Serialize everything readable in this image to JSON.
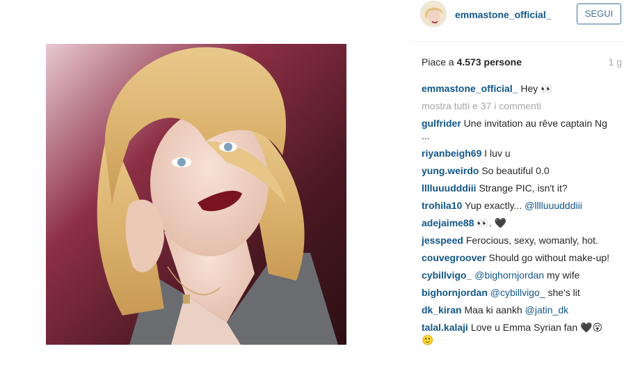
{
  "post": {
    "username": "emmastone_official_",
    "follow_label": "SEGUI",
    "likes_prefix": "Piace a ",
    "likes_count": "4.573 persone",
    "time_ago": "1 g",
    "caption_author": "emmastone_official_",
    "caption_text": "Hey 👀",
    "show_all_comments": "mostra tutti e 37 i commenti"
  },
  "comments": [
    {
      "author": "gulfrider",
      "text": "Une invitation au rêve captain Ng ..."
    },
    {
      "author": "riyanbeigh69",
      "text": "I luv u"
    },
    {
      "author": "yung.weirdo",
      "text": "So beautiful 0.0"
    },
    {
      "author": "lllluuudddiii",
      "text": "Strange PIC, isn't it?"
    },
    {
      "author": "trohila10",
      "text": "Yup exactly... ",
      "mention": "@lllluuudddiii"
    },
    {
      "author": "adejaime88",
      "text": "👀. 🖤"
    },
    {
      "author": "jesspeed",
      "text": "Ferocious, sexy, womanly, hot."
    },
    {
      "author": "couvegroover",
      "text": "Should go without make-up!"
    },
    {
      "author": "cybillvigo_",
      "mention": "@bighornjordan",
      "text": " my wife"
    },
    {
      "author": "bighornjordan",
      "mention": "@cybillvigo_",
      "text": " she's lit"
    },
    {
      "author": "dk_kiran",
      "text": "Maa ki aankh ",
      "mention": "@jatin_dk"
    },
    {
      "author": "talal.kalaji",
      "text": "Love u Emma Syrian fan 🖤😮 🙂"
    }
  ],
  "icons": {
    "photo": "portrait-photo",
    "avatar": "avatar-image"
  },
  "colors": {
    "link_blue": "#125688",
    "follow_blue": "#3f729b",
    "muted_gray": "#a5a7aa"
  }
}
